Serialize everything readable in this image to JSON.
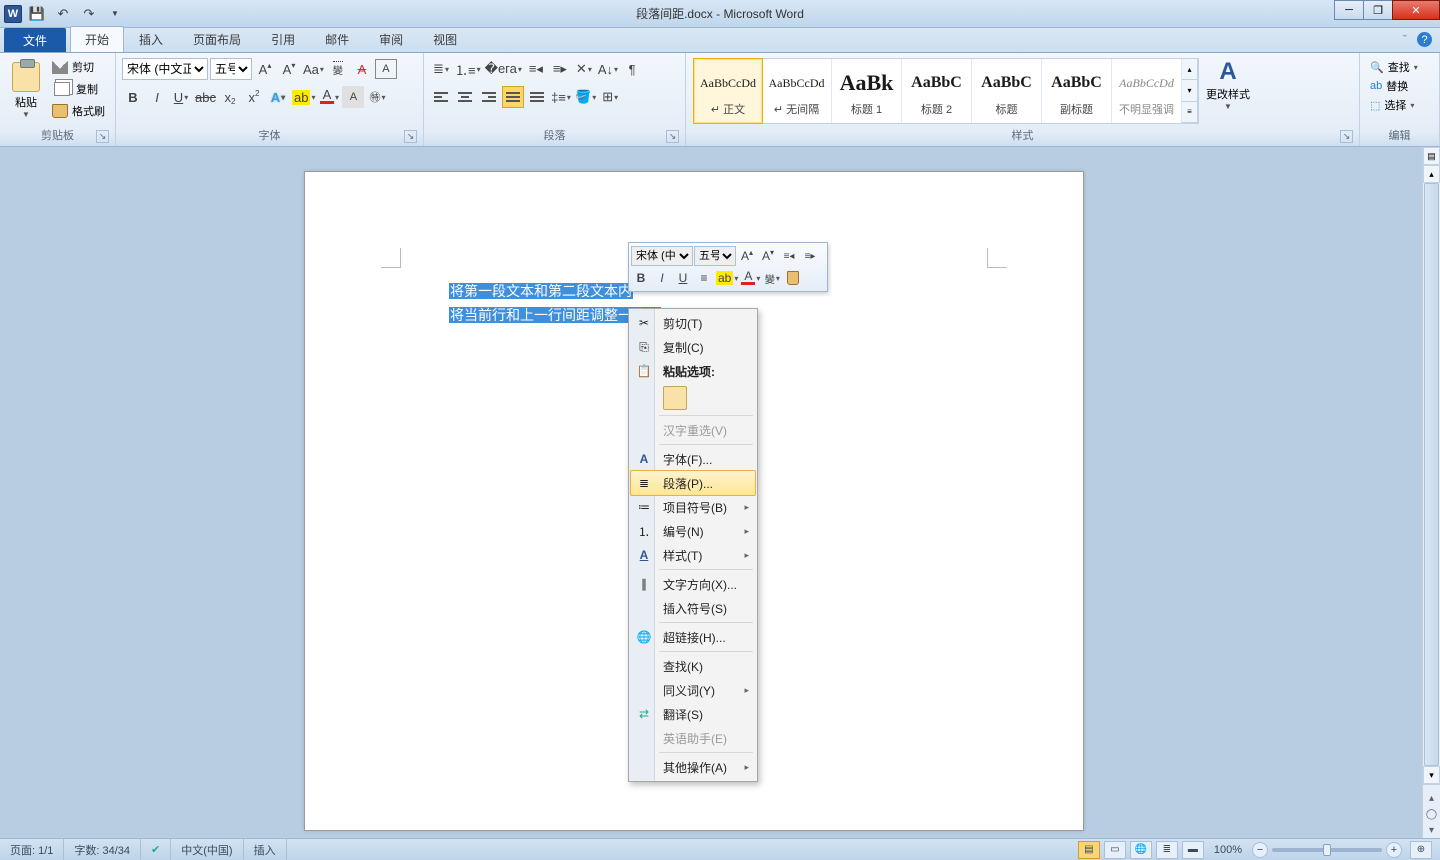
{
  "title": "段落间距.docx - Microsoft Word",
  "qat": {
    "app_letter": "W"
  },
  "tabs": {
    "file": "文件",
    "items": [
      "开始",
      "插入",
      "页面布局",
      "引用",
      "邮件",
      "审阅",
      "视图"
    ],
    "active_index": 0
  },
  "ribbon": {
    "clipboard": {
      "label": "剪贴板",
      "paste": "粘贴",
      "cut": "剪切",
      "copy": "复制",
      "format_painter": "格式刷"
    },
    "font": {
      "label": "字体",
      "font_name": "宋体 (中文正文)",
      "font_size": "五号"
    },
    "paragraph": {
      "label": "段落"
    },
    "styles": {
      "label": "样式",
      "change": "更改样式",
      "items": [
        {
          "preview": "AaBbCcDd",
          "name": "↵ 正文",
          "size": "12px",
          "color": "#1a1a1a",
          "sel": true
        },
        {
          "preview": "AaBbCcDd",
          "name": "↵ 无间隔",
          "size": "12px",
          "color": "#1a1a1a"
        },
        {
          "preview": "AaBk",
          "name": "标题 1",
          "size": "22px",
          "color": "#000",
          "bold": true
        },
        {
          "preview": "AaBbC",
          "name": "标题 2",
          "size": "16px",
          "color": "#000",
          "bold": true
        },
        {
          "preview": "AaBbC",
          "name": "标题",
          "size": "16px",
          "color": "#000",
          "bold": true
        },
        {
          "preview": "AaBbC",
          "name": "副标题",
          "size": "16px",
          "color": "#000",
          "bold": true
        },
        {
          "preview": "AaBbCcDd",
          "name": "不明显强调",
          "size": "12px",
          "color": "#888",
          "italic": true
        }
      ]
    },
    "editing": {
      "label": "编辑",
      "find": "查找",
      "replace": "替换",
      "select": "选择"
    }
  },
  "document": {
    "line1": "将第一段文本和第二段文本内",
    "line2": "将当前行和上一行间距调整一些。"
  },
  "mini_toolbar": {
    "font_name": "宋体 (中文",
    "font_size": "五号"
  },
  "context_menu": {
    "cut": "剪切(T)",
    "copy": "复制(C)",
    "paste_options": "粘贴选项:",
    "reconvert": "汉字重选(V)",
    "font": "字体(F)...",
    "paragraph": "段落(P)...",
    "bullets": "项目符号(B)",
    "numbering": "编号(N)",
    "styles": "样式(T)",
    "text_direction": "文字方向(X)...",
    "insert_symbol": "插入符号(S)",
    "hyperlink": "超链接(H)...",
    "lookup": "查找(K)",
    "synonyms": "同义词(Y)",
    "translate": "翻译(S)",
    "eng_assist": "英语助手(E)",
    "other": "其他操作(A)"
  },
  "statusbar": {
    "page": "页面: 1/1",
    "words": "字数: 34/34",
    "lang": "中文(中国)",
    "mode": "插入",
    "zoom": "100%"
  }
}
